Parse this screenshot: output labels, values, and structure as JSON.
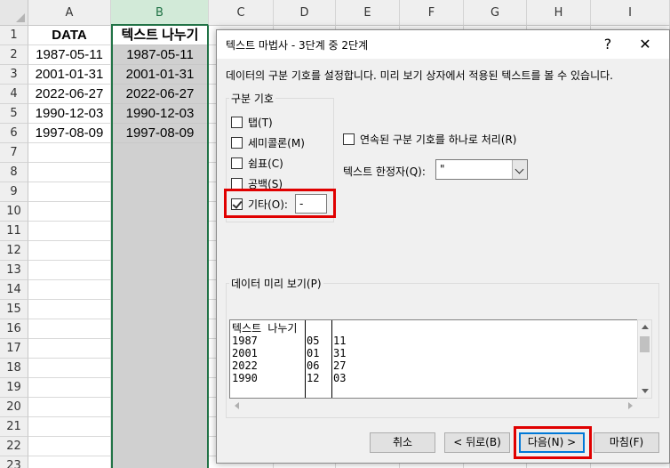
{
  "sheet": {
    "columns": [
      "A",
      "B",
      "C",
      "D",
      "E",
      "F",
      "G",
      "H",
      "I"
    ],
    "rows": [
      "1",
      "2",
      "3",
      "4",
      "5",
      "6",
      "7",
      "8",
      "9",
      "10",
      "11",
      "12",
      "13",
      "14",
      "15",
      "16",
      "17",
      "18",
      "19",
      "20",
      "21",
      "22",
      "23"
    ],
    "colA": [
      "DATA",
      "1987-05-11",
      "2001-01-31",
      "2022-06-27",
      "1990-12-03",
      "1997-08-09"
    ],
    "colB": [
      "텍스트 나누기",
      "1987-05-11",
      "2001-01-31",
      "2022-06-27",
      "1990-12-03",
      "1997-08-09"
    ]
  },
  "dialog": {
    "title": "텍스트 마법사 - 3단계 중 2단계",
    "help": "?",
    "close": "✕",
    "instruction": "데이터의 구분 기호를 설정합니다. 미리 보기 상자에서 적용된 텍스트를 볼 수 있습니다.",
    "delimiters": {
      "label": "구분 기호",
      "tab": "탭(T)",
      "semicolon": "세미콜론(M)",
      "comma": "쉼표(C)",
      "space": "공백(S)",
      "other": "기타(O):",
      "other_value": "-"
    },
    "consecutive": "연속된 구분 기호를 하나로 처리(R)",
    "qualifier_label": "텍스트 한정자(Q):",
    "qualifier_value": "\"",
    "preview_label": "데이터 미리 보기(P)",
    "preview": {
      "col1": [
        "텍스트 나누기",
        "1987",
        "2001",
        "2022",
        "1990"
      ],
      "col2": [
        "",
        "05",
        "01",
        "06",
        "12"
      ],
      "col3": [
        "",
        "11",
        "31",
        "27",
        "03"
      ]
    },
    "buttons": {
      "cancel": "취소",
      "back": "< 뒤로(B)",
      "next": "다음(N) >",
      "finish": "마침(F)"
    }
  }
}
